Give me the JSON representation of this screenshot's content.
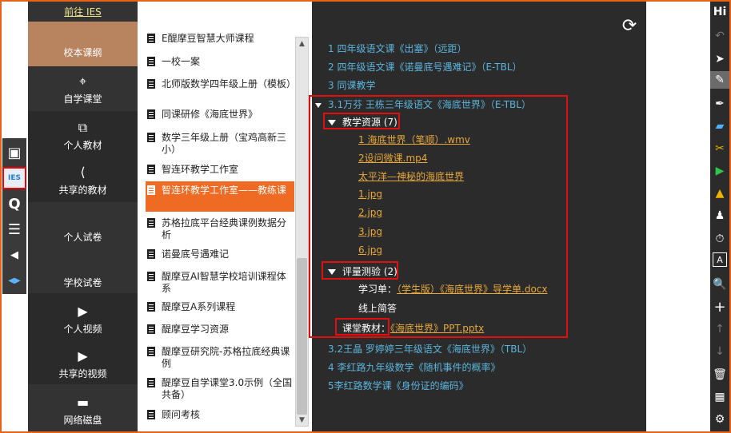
{
  "nav": {
    "top_link": "前往 IES",
    "items": [
      {
        "label": "校本课纲",
        "icon": "book-icon"
      },
      {
        "label": "自学课堂",
        "icon": "satellite-icon"
      },
      {
        "label": "个人教材",
        "icon": "copy-icon"
      },
      {
        "label": "共享的教材",
        "icon": "share-icon"
      },
      {
        "label": "个人试卷",
        "icon": ""
      },
      {
        "label": "学校试卷",
        "icon": ""
      },
      {
        "label": "个人视频",
        "icon": "play-icon"
      },
      {
        "label": "共享的视频",
        "icon": "play-icon"
      },
      {
        "label": "网络磁盘",
        "icon": "drive-icon"
      }
    ],
    "glyphs": {
      "copy": "⧉",
      "share": "⟨",
      "play": "▶",
      "drive": "▬",
      "satellite": "⌖"
    }
  },
  "left_tools": {
    "glyphs": {
      "image": "▣",
      "ies": "IES",
      "q": "Q",
      "menu": "☰",
      "left": "◀",
      "expand": "◀▶"
    }
  },
  "course_list": {
    "items": [
      "E醍摩豆智慧大师课程",
      "一校一案",
      "北师版数学四年级上册（模板）",
      "同课研修《海底世界》",
      "数学三年级上册（宝鸡高新三小）",
      "智连环教学工作室",
      "智连环教学工作室——教练课",
      "苏格拉底平台经典课例数据分析",
      "诺曼底号遇难记",
      "醍摩豆AI智慧学校培训课程体系",
      "醍摩豆A系列课程",
      "醍摩豆学习资源",
      "醍摩豆研究院-苏格拉底经典课例",
      "醍摩豆自学课堂3.0示例（全国共备）",
      "顾问考核"
    ],
    "active_index": 6,
    "scroll_up": "▲",
    "scroll_down": "▼"
  },
  "main": {
    "refresh_glyph": "⟳",
    "lessons_before": [
      "1 四年级语文课《出塞》（远距）",
      "2 四年级语文课《诺曼底号遇难记》（E-TBL）",
      "3 同课教学"
    ],
    "expanded_lesson": "3.1万芬  王栋三年级语文《海底世界》（E-TBL）",
    "teaching_resources": {
      "header": "教学资源 (7)",
      "files": [
        "1 海底世界（笔顺）.wmv",
        "2设问微课.mp4",
        "太平洋—神秘的海底世界",
        "1.jpg",
        "2.jpg",
        "3.jpg",
        "6.jpg"
      ]
    },
    "assessment": {
      "header": "评量测验 (2)",
      "worksheet_label": "学习单：",
      "worksheet_file": "（学生版）《海底世界》导学单.docx",
      "online_quiz": "线上简答"
    },
    "class_material": {
      "label": "课堂教材：",
      "file": "《海底世界》PPT.pptx"
    },
    "lessons_after": [
      "3.2王晶 罗婷婷三年级语文《海底世界》（TBL）",
      "4 李红路九年级数学《随机事件的概率》",
      "5李红路数学课《身份证的编码》"
    ]
  },
  "right_tools": {
    "title": "Hi",
    "glyphs": [
      "↶",
      "➤",
      "✎",
      "✒",
      "▰",
      "✂",
      "▶",
      "▲",
      "♟",
      "⏱",
      "A",
      "🔍",
      "+",
      "↑",
      "↓",
      "🗑",
      "▦",
      "⚙"
    ]
  }
}
